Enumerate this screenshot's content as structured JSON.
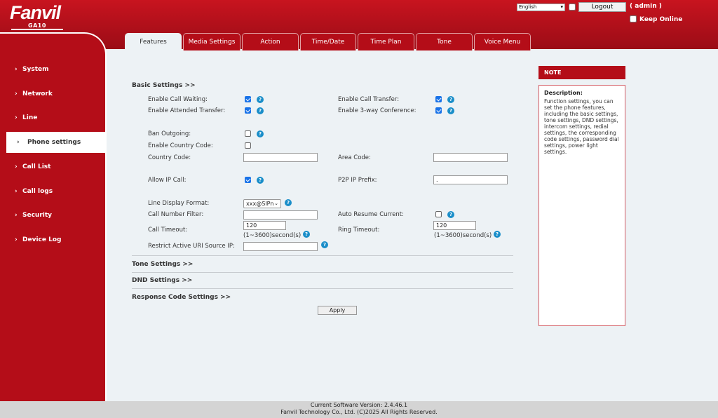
{
  "brand": {
    "logo": "Fanvil",
    "model": "GA10"
  },
  "header": {
    "language": "English",
    "logout_label": "Logout",
    "user_label": "( admin )",
    "keep_online_label": "Keep Online"
  },
  "tabs": [
    {
      "label": "Features",
      "active": true
    },
    {
      "label": "Media Settings"
    },
    {
      "label": "Action"
    },
    {
      "label": "Time/Date"
    },
    {
      "label": "Time Plan"
    },
    {
      "label": "Tone"
    },
    {
      "label": "Voice Menu"
    }
  ],
  "sidebar": {
    "arrow": "›",
    "items": [
      {
        "label": "System"
      },
      {
        "label": "Network"
      },
      {
        "label": "Line"
      },
      {
        "label": "Phone settings",
        "active": true
      },
      {
        "label": "Call List"
      },
      {
        "label": "Call logs"
      },
      {
        "label": "Security"
      },
      {
        "label": "Device Log"
      }
    ]
  },
  "basic": {
    "title": "Basic Settings >>",
    "enable_call_waiting": {
      "label": "Enable Call Waiting:",
      "checked": true
    },
    "enable_call_transfer": {
      "label": "Enable Call Transfer:",
      "checked": true
    },
    "enable_attended_transfer": {
      "label": "Enable Attended Transfer:",
      "checked": true
    },
    "enable_3way": {
      "label": "Enable 3-way Conference:",
      "checked": true
    },
    "ban_outgoing": {
      "label": "Ban Outgoing:",
      "checked": false
    },
    "enable_country_code": {
      "label": "Enable Country Code:",
      "checked": false
    },
    "country_code": {
      "label": "Country Code:",
      "value": ""
    },
    "area_code": {
      "label": "Area Code:",
      "value": ""
    },
    "allow_ip_call": {
      "label": "Allow IP Call:",
      "checked": true
    },
    "p2p_ip_prefix": {
      "label": "P2P IP Prefix:",
      "value": "."
    },
    "line_display_format": {
      "label": "Line Display Format:",
      "value": "xxx@SIPn"
    },
    "call_number_filter": {
      "label": "Call Number Filter:",
      "value": ""
    },
    "auto_resume_current": {
      "label": "Auto Resume Current:",
      "checked": false
    },
    "call_timeout": {
      "label": "Call Timeout:",
      "value": "120",
      "hint": "(1~3600)second(s)"
    },
    "ring_timeout": {
      "label": "Ring Timeout:",
      "value": "120",
      "hint": "(1~3600)second(s)"
    },
    "restrict_uri": {
      "label": "Restrict Active URI Source IP:",
      "value": ""
    }
  },
  "sections": {
    "tone": "Tone Settings >>",
    "dnd": "DND Settings >>",
    "response_code": "Response Code Settings >>"
  },
  "apply_label": "Apply",
  "help_glyph": "?",
  "note": {
    "header": "NOTE",
    "title": "Description:",
    "body": "Function settings, you can set the phone features, including the basic settings, tone settings, DND settings, intercom settings, redial settings, the corresponding code settings, password dial settings, power light settings."
  },
  "footer": {
    "version": "Current Software Version: 2.4.46.1",
    "copyright": "Fanvil Technology Co., Ltd. (C)2025 All Rights Reserved."
  },
  "colors": {
    "brand_red": "#b40d18",
    "help_blue": "#1a8ec9",
    "check_blue": "#1a73e8",
    "panel_bg": "#edf2f5"
  }
}
